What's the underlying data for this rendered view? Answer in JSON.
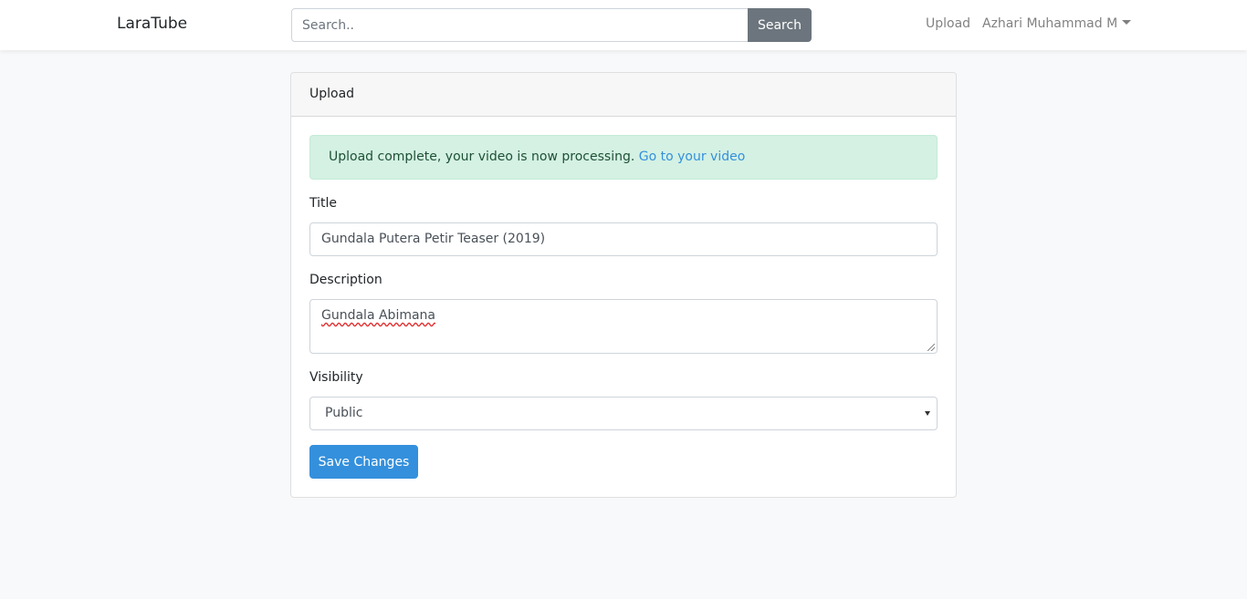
{
  "navbar": {
    "brand": "LaraTube",
    "search_placeholder": "Search..",
    "search_button": "Search",
    "upload_link": "Upload",
    "user_name": "Azhari Muhammad M"
  },
  "card": {
    "header": "Upload",
    "alert": {
      "message": "Upload complete, your video is now processing.",
      "link": "Go to your video"
    },
    "form": {
      "title_label": "Title",
      "title_value": "Gundala Putera Petir Teaser (2019)",
      "description_label": "Description",
      "description_value": "Gundala Abimana",
      "visibility_label": "Visibility",
      "visibility_value": "Public",
      "save_button": "Save Changes"
    }
  },
  "colors": {
    "primary": "#3490dc",
    "secondary": "#6c757d",
    "success_bg": "#d4f1e3",
    "page_bg": "#f8f9fa"
  }
}
